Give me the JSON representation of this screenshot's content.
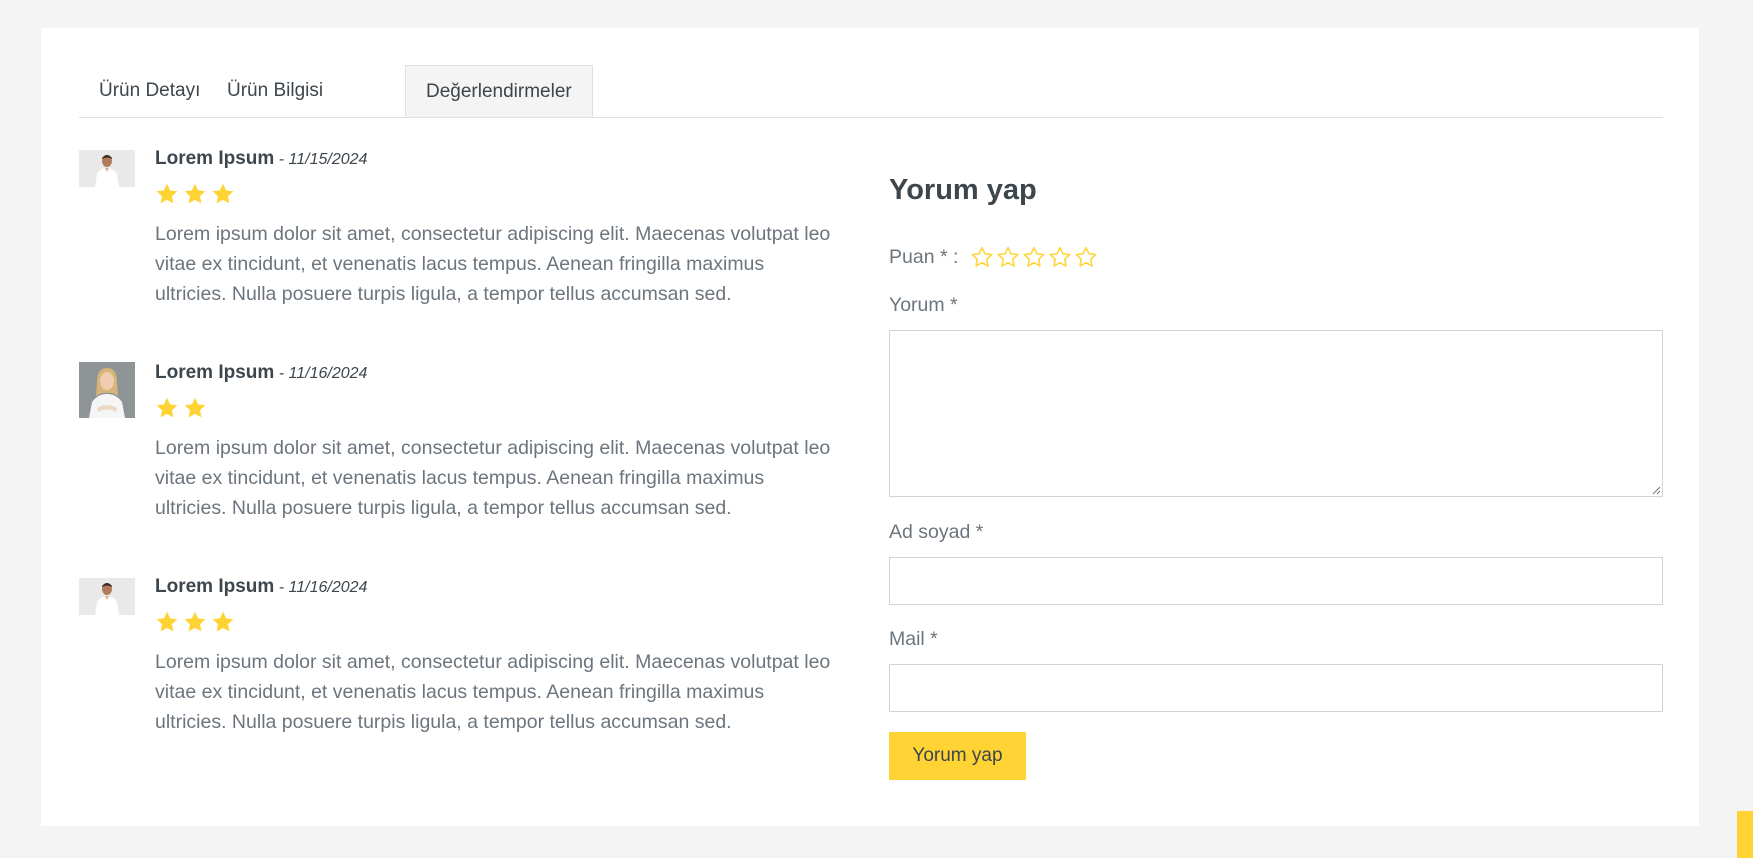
{
  "tabs": [
    {
      "label": "Ürün Detayı",
      "active": false
    },
    {
      "label": "Ürün Bilgisi",
      "active": false
    },
    {
      "label": "Değerlendirmeler",
      "active": true
    }
  ],
  "reviews": [
    {
      "name": "Lorem Ipsum",
      "separator": " - ",
      "date": "11/15/2024",
      "rating": 3,
      "avatar": "man-avatar",
      "text": "Lorem ipsum dolor sit amet, consectetur adipiscing elit. Maecenas volutpat leo vitae ex tincidunt, et venenatis lacus tempus. Aenean fringilla maximus ultricies. Nulla posuere turpis ligula, a tempor tellus accumsan sed."
    },
    {
      "name": "Lorem Ipsum",
      "separator": " - ",
      "date": "11/16/2024",
      "rating": 2,
      "avatar": "woman-avatar",
      "text": "Lorem ipsum dolor sit amet, consectetur adipiscing elit. Maecenas volutpat leo vitae ex tincidunt, et venenatis lacus tempus. Aenean fringilla maximus ultricies. Nulla posuere turpis ligula, a tempor tellus accumsan sed."
    },
    {
      "name": "Lorem Ipsum",
      "separator": " - ",
      "date": "11/16/2024",
      "rating": 3,
      "avatar": "man-avatar",
      "text": "Lorem ipsum dolor sit amet, consectetur adipiscing elit. Maecenas volutpat leo vitae ex tincidunt, et venenatis lacus tempus. Aenean fringilla maximus ultricies. Nulla posuere turpis ligula, a tempor tellus accumsan sed."
    }
  ],
  "form": {
    "title": "Yorum yap",
    "rating_label": "Puan * :",
    "rating_value": 0,
    "rating_max": 5,
    "comment_label": "Yorum *",
    "comment_value": "",
    "name_label": "Ad soyad *",
    "name_value": "",
    "mail_label": "Mail *",
    "mail_value": "",
    "submit_label": "Yorum yap"
  },
  "colors": {
    "accent": "#ffd333",
    "star": "#ffd333",
    "heading": "#3d464d",
    "text": "#6c757d",
    "page_bg": "#f4f4f4"
  },
  "icons": {
    "star_full": "star-icon",
    "star_empty": "star-outline-icon"
  }
}
